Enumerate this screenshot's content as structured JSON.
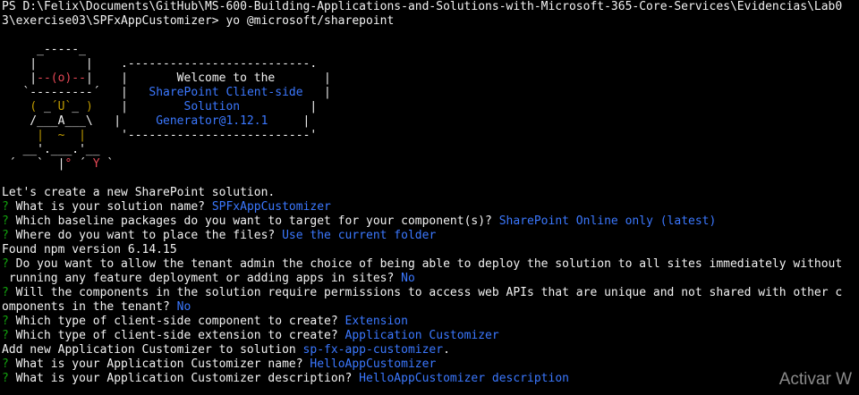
{
  "lines": [
    [
      {
        "t": "PS D:\\Felix\\Documents\\GitHub\\MS-600-Building-Applications-and-Solutions-with-Microsoft-365-Core-Services\\Evidencias\\Lab0",
        "c": "w"
      }
    ],
    [
      {
        "t": "3\\exercise03\\SPFxAppCustomizer> yo @microsoft/sharepoint",
        "c": "w"
      }
    ],
    [],
    [
      {
        "t": "     _-----_",
        "c": "w"
      }
    ],
    [
      {
        "t": "    |       |    .--------------------------.",
        "c": "w"
      }
    ],
    [
      {
        "t": "    |",
        "c": "w"
      },
      {
        "t": "--(o)--",
        "c": "r"
      },
      {
        "t": "|    |       Welcome to the       |",
        "c": "w"
      }
    ],
    [
      {
        "t": "   `---------´   |   ",
        "c": "w"
      },
      {
        "t": "SharePoint Client-side",
        "c": "a"
      },
      {
        "t": "   |",
        "c": "w"
      }
    ],
    [
      {
        "t": "    ",
        "c": "w"
      },
      {
        "t": "( ",
        "c": "y"
      },
      {
        "t": "_",
        "c": "w"
      },
      {
        "t": "´U`",
        "c": "y"
      },
      {
        "t": "_ ",
        "c": "w"
      },
      {
        "t": ")",
        "c": "y"
      },
      {
        "t": "    |        ",
        "c": "w"
      },
      {
        "t": "Solution",
        "c": "a"
      },
      {
        "t": "          |",
        "c": "w"
      }
    ],
    [
      {
        "t": "    /___A___\\   |     ",
        "c": "w"
      },
      {
        "t": "Generator@1.12.1",
        "c": "a"
      },
      {
        "t": "     |",
        "c": "w"
      }
    ],
    [
      {
        "t": "     ",
        "c": "w"
      },
      {
        "t": "|  ~  |",
        "c": "y"
      },
      {
        "t": "     '--------------------------'",
        "c": "w"
      }
    ],
    [
      {
        "t": "   __'.___.'__",
        "c": "w"
      }
    ],
    [
      {
        "t": " ´   `  |",
        "c": "w"
      },
      {
        "t": "°",
        "c": "r"
      },
      {
        "t": " ´ ",
        "c": "w"
      },
      {
        "t": "Y",
        "c": "r"
      },
      {
        "t": " `",
        "c": "w"
      }
    ],
    [],
    [
      {
        "t": "Let's create a new SharePoint solution.",
        "c": "w"
      }
    ],
    [
      {
        "t": "? ",
        "c": "q"
      },
      {
        "t": "What is your solution name? ",
        "c": "w"
      },
      {
        "t": "SPFxAppCustomizer",
        "c": "a"
      }
    ],
    [
      {
        "t": "? ",
        "c": "q"
      },
      {
        "t": "Which baseline packages do you want to target for your component(s)? ",
        "c": "w"
      },
      {
        "t": "SharePoint Online only (latest)",
        "c": "a"
      }
    ],
    [
      {
        "t": "? ",
        "c": "q"
      },
      {
        "t": "Where do you want to place the files? ",
        "c": "w"
      },
      {
        "t": "Use the current folder",
        "c": "a"
      }
    ],
    [
      {
        "t": "Found npm version 6.14.15",
        "c": "w"
      }
    ],
    [
      {
        "t": "? ",
        "c": "q"
      },
      {
        "t": "Do you want to allow the tenant admin the choice of being able to deploy the solution to all sites immediately without",
        "c": "w"
      }
    ],
    [
      {
        "t": " running any feature deployment or adding apps in sites? ",
        "c": "w"
      },
      {
        "t": "No",
        "c": "a"
      }
    ],
    [
      {
        "t": "? ",
        "c": "q"
      },
      {
        "t": "Will the components in the solution require permissions to access web APIs that are unique and not shared with other c",
        "c": "w"
      }
    ],
    [
      {
        "t": "omponents in the tenant? ",
        "c": "w"
      },
      {
        "t": "No",
        "c": "a"
      }
    ],
    [
      {
        "t": "? ",
        "c": "q"
      },
      {
        "t": "Which type of client-side component to create? ",
        "c": "w"
      },
      {
        "t": "Extension",
        "c": "a"
      }
    ],
    [
      {
        "t": "? ",
        "c": "q"
      },
      {
        "t": "Which type of client-side extension to create? ",
        "c": "w"
      },
      {
        "t": "Application Customizer",
        "c": "a"
      }
    ],
    [
      {
        "t": "Add new Application Customizer to solution ",
        "c": "w"
      },
      {
        "t": "sp-fx-app-customizer",
        "c": "a"
      },
      {
        "t": ".",
        "c": "w"
      }
    ],
    [
      {
        "t": "? ",
        "c": "q"
      },
      {
        "t": "What is your Application Customizer name? ",
        "c": "w"
      },
      {
        "t": "HelloAppCustomizer",
        "c": "a"
      }
    ],
    [
      {
        "t": "? ",
        "c": "q"
      },
      {
        "t": "What is your Application Customizer description? ",
        "c": "w"
      },
      {
        "t": "HelloAppCustomizer description",
        "c": "a"
      }
    ]
  ],
  "watermark": "Activar W"
}
